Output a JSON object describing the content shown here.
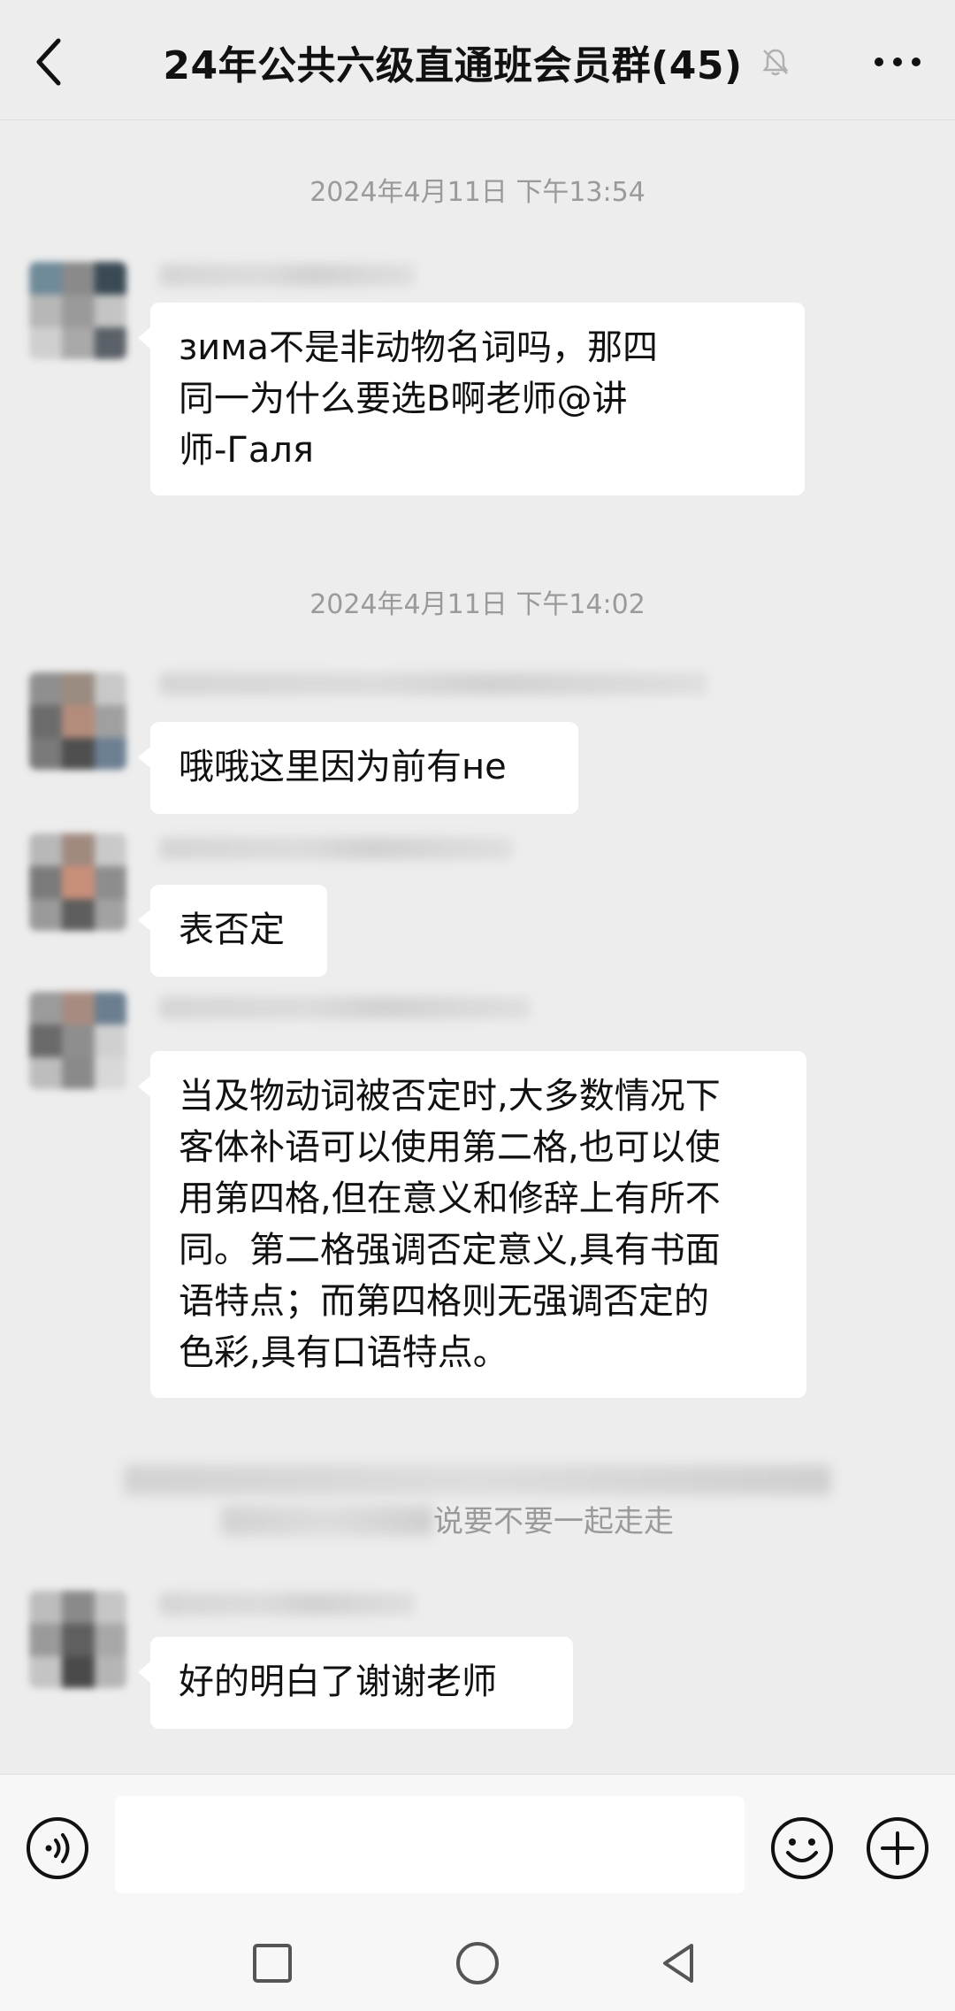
{
  "header": {
    "title": "24年公共六级直通班会员群(45)",
    "back_icon": "chevron-left-icon",
    "mute_icon": "bell-off-icon",
    "more_icon": "more-dots-icon"
  },
  "messages": [
    {
      "type": "timestamp",
      "text": "2024年4月11日 下午13:54"
    },
    {
      "type": "message",
      "text_lines": [
        "зима不是非动物名词吗，那四",
        "同一为什么要选B啊老师@讲",
        "师-Галя"
      ]
    },
    {
      "type": "timestamp",
      "text": "2024年4月11日 下午14:02"
    },
    {
      "type": "message",
      "text": "哦哦这里因为前有не"
    },
    {
      "type": "message",
      "text": "表否定"
    },
    {
      "type": "message",
      "text_lines": [
        "当及物动词被否定时,大多数情况下",
        "客体补语可以使用第二格,也可以使",
        "用第四格,但在意义和修辞上有所不",
        "同。第二格强调否定意义,具有书面",
        "语特点；而第四格则无强调否定的",
        "色彩,具有口语特点。"
      ]
    },
    {
      "type": "system",
      "text": "说要不要一起走走"
    },
    {
      "type": "message",
      "text": "好的明白了谢谢老师"
    }
  ],
  "input_bar": {
    "voice_icon": "voice-icon",
    "input_value": "",
    "emoji_icon": "emoji-icon",
    "plus_icon": "plus-circle-icon"
  },
  "nav_bar": {
    "recent_icon": "square-icon",
    "home_icon": "circle-icon",
    "back_icon": "triangle-back-icon"
  },
  "colors": {
    "background": "#ededed",
    "bubble": "#ffffff",
    "timestamp_text": "#9a9a9a",
    "title_text": "#111111"
  }
}
